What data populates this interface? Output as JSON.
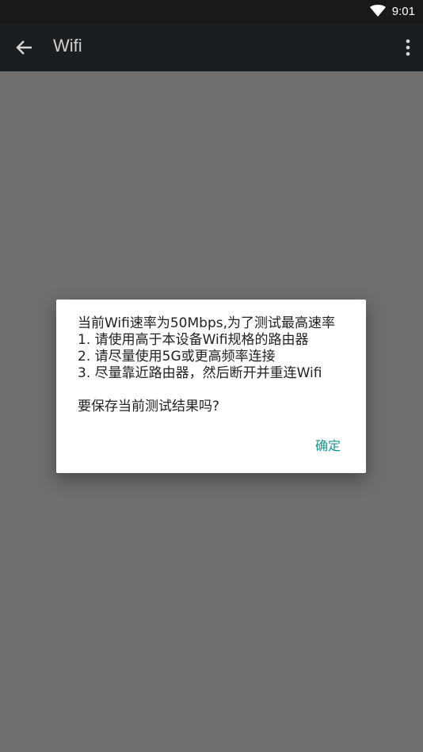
{
  "status_bar": {
    "time": "9:01",
    "wifi_icon": "wifi-icon"
  },
  "app_bar": {
    "title": "Wifi",
    "back_icon": "back-arrow-icon",
    "menu_icon": "overflow-menu-icon"
  },
  "dialog": {
    "lines": [
      "当前Wifi速率为50Mbps,为了测试最高速率",
      "1. 请使用高于本设备Wifi规格的路由器",
      "2. 请尽量使用5G或更高频率连接",
      "3. 尽量靠近路由器，然后断开并重连Wifi"
    ],
    "question": "要保存当前测试结果吗?",
    "confirm_label": "确定",
    "confirm_color": "#13978b"
  },
  "colors": {
    "status_bar_bg": "#17191b",
    "app_bar_bg": "#1b1e20",
    "scrim_bg": "#6e6e6e",
    "dialog_bg": "#ffffff"
  }
}
